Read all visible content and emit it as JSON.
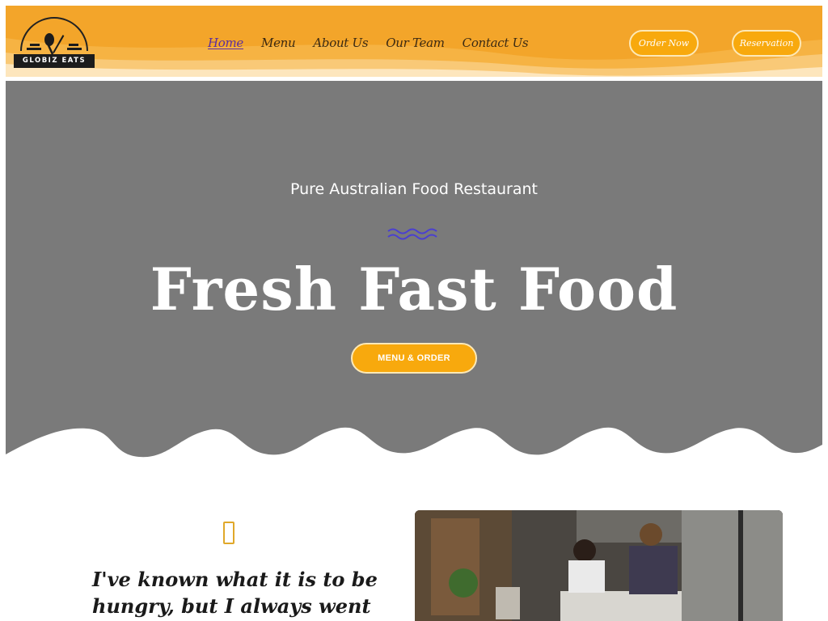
{
  "header": {
    "logo_text": "GLOBIZ EATS",
    "nav": [
      {
        "label": "Home",
        "active": true
      },
      {
        "label": "Menu",
        "active": false
      },
      {
        "label": "About Us",
        "active": false
      },
      {
        "label": "Our Team",
        "active": false
      },
      {
        "label": "Contact Us",
        "active": false
      }
    ],
    "order_label": "Order Now",
    "reservation_label": "Reservation"
  },
  "hero": {
    "subtitle": "Pure Australian Food Restaurant",
    "title": "Fresh Fast Food",
    "cta_label": "MENU & ORDER"
  },
  "testimonial": {
    "quote": "I've known what it is to be hungry, but I always went"
  },
  "colors": {
    "accent": "#f8a90d",
    "header_bg": "#f3a52a",
    "hero_bg": "#7a7a7a",
    "nav_active": "#5b2fa0",
    "squiggle": "#4a3fd0"
  },
  "icons": {
    "logo": "fork-spoon-knife-icon",
    "squiggle": "wavy-divider-icon",
    "quote": "quote-icon"
  }
}
